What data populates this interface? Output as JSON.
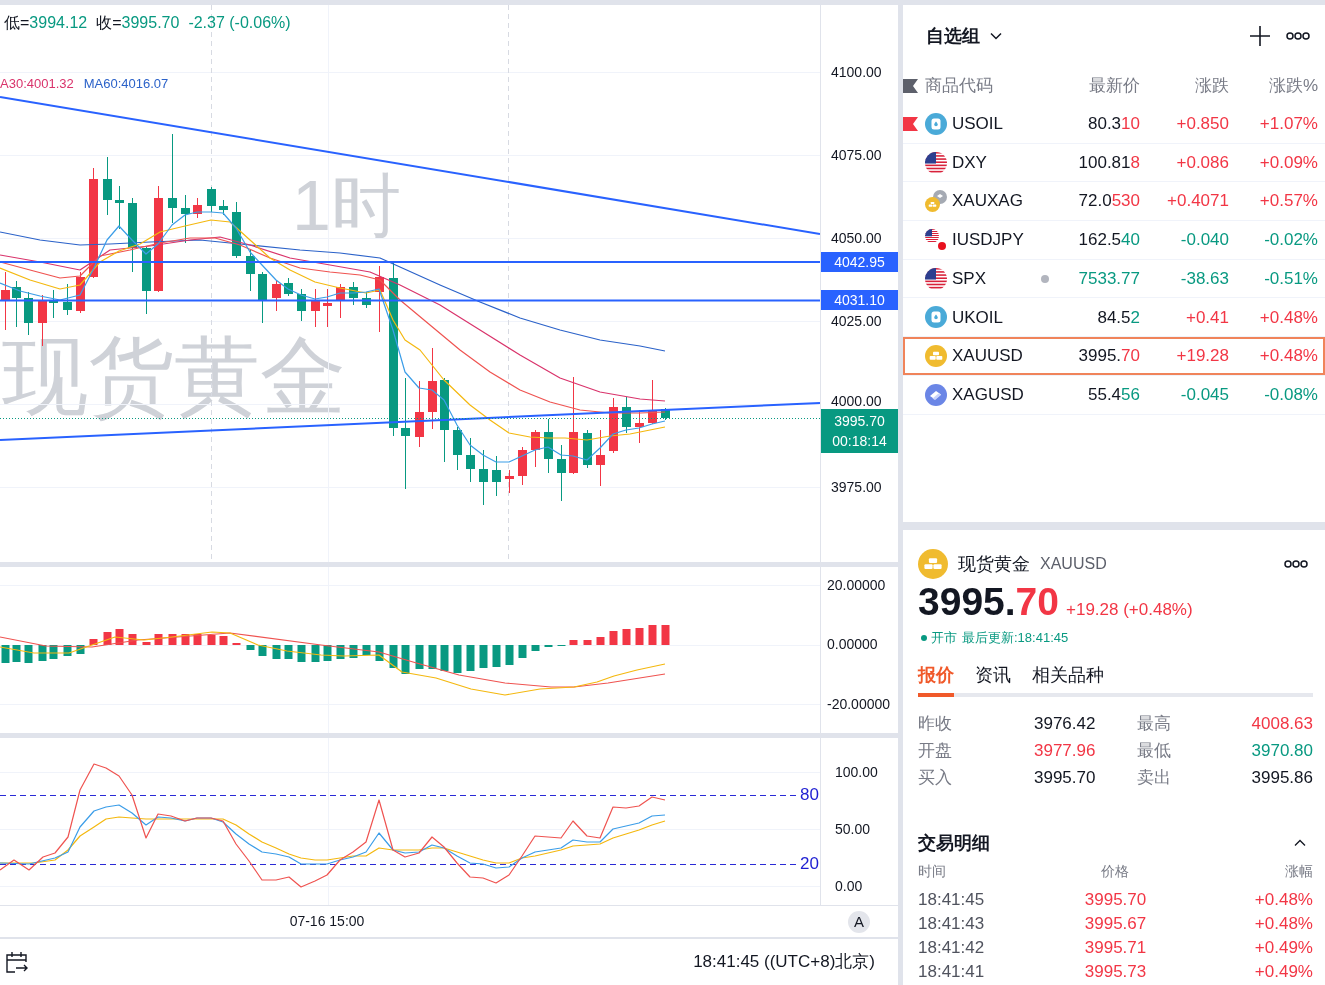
{
  "chart": {
    "legend": {
      "fields": [
        {
          "label": "低=",
          "value": "3994.12"
        },
        {
          "label": "收=",
          "value": "3995.70"
        }
      ],
      "change": "-2.37 (-0.06%)",
      "rising": false
    },
    "ma_legend": [
      {
        "label": "A30:4001.32",
        "color": "#d9336b"
      },
      {
        "label": "MA60:4016.07",
        "color": "#2b62c9"
      }
    ],
    "watermark": [
      "1时",
      "现货黄金"
    ],
    "price_axis": [
      {
        "kind": "tick",
        "label": "4100.00"
      },
      {
        "kind": "tick",
        "label": "4075.00"
      },
      {
        "kind": "tick",
        "label": "4050.00"
      },
      {
        "kind": "line",
        "label": "4042.95"
      },
      {
        "kind": "line",
        "label": "4031.10"
      },
      {
        "kind": "tick",
        "label": "4025.00"
      },
      {
        "kind": "tick",
        "label": "4000.00"
      },
      {
        "kind": "last",
        "label": "3995.70",
        "countdown": "00:18:14"
      },
      {
        "kind": "tick",
        "label": "3975.00"
      }
    ],
    "macd_axis": [
      "20.00000",
      "0.00000",
      "-20.00000"
    ],
    "stoch_axis": [
      "100.00",
      "50.00",
      "0.00"
    ],
    "stoch_levels": [
      "80",
      "20"
    ],
    "time_axis": [
      "07-16 15:00"
    ],
    "scale_button": "A"
  },
  "status_bar": {
    "clock": "18:41:45 ((UTC+8)北京)"
  },
  "watchlist": {
    "title": "自选组",
    "columns": [
      "商品代码",
      "最新价",
      "涨跌",
      "涨跌%"
    ],
    "rows": [
      {
        "symbol": "USOIL",
        "kind": "oil",
        "flagged": true,
        "closed": false,
        "selected": false,
        "price_head": "80.3",
        "price_tail": "10",
        "tick_rising": true,
        "change": "+0.850",
        "change_pct": "+1.07%",
        "rising": true
      },
      {
        "symbol": "DXY",
        "kind": "flag",
        "flagged": false,
        "closed": false,
        "selected": false,
        "price_head": "100.81",
        "price_tail": "8",
        "tick_rising": true,
        "change": "+0.086",
        "change_pct": "+0.09%",
        "rising": true
      },
      {
        "symbol": "XAUXAG",
        "kind": "ratio",
        "flagged": false,
        "closed": false,
        "selected": false,
        "price_head": "72.0",
        "price_tail": "530",
        "tick_rising": true,
        "change": "+0.4071",
        "change_pct": "+0.57%",
        "rising": true
      },
      {
        "symbol": "IUSDJPY",
        "kind": "pair",
        "flagged": false,
        "closed": false,
        "selected": false,
        "price_head": "162.5",
        "price_tail": "40",
        "tick_rising": false,
        "change": "-0.040",
        "change_pct": "-0.02%",
        "rising": false
      },
      {
        "symbol": "SPX",
        "kind": "flag",
        "flagged": false,
        "closed": true,
        "selected": false,
        "price_tail": "7533.77",
        "tick_rising": false,
        "change": "-38.63",
        "change_pct": "-0.51%",
        "rising": false
      },
      {
        "symbol": "UKOIL",
        "kind": "oil",
        "flagged": false,
        "closed": false,
        "selected": false,
        "price_head": "84.5",
        "price_tail": "2",
        "tick_rising": false,
        "change": "+0.41",
        "change_pct": "+0.48%",
        "rising": true
      },
      {
        "symbol": "XAUUSD",
        "kind": "bullion",
        "flagged": false,
        "closed": false,
        "selected": true,
        "price_head": "3995.",
        "price_tail": "70",
        "tick_rising": true,
        "change": "+19.28",
        "change_pct": "+0.48%",
        "rising": true
      },
      {
        "symbol": "XAGUSD",
        "kind": "ingot",
        "flagged": false,
        "closed": false,
        "selected": false,
        "price_head": "55.4",
        "price_tail": "56",
        "tick_rising": false,
        "change": "-0.045",
        "change_pct": "-0.08%",
        "rising": false
      }
    ]
  },
  "detail": {
    "name": "现货黄金",
    "symbol": "XAUUSD",
    "price_head": "3995.",
    "price_tail": "70",
    "tick_rising": true,
    "change": "+19.28 (+0.48%)",
    "rising": true,
    "market_open": true,
    "market_status": "开市",
    "updated": "最后更新:18:41:45",
    "tabs": [
      {
        "label": "报价",
        "selected": true
      },
      {
        "label": "资讯",
        "selected": false
      },
      {
        "label": "相关品种",
        "selected": false
      }
    ],
    "stats": [
      {
        "label": "昨收",
        "value": "3976.42",
        "color": "#131722"
      },
      {
        "label": "最高",
        "value": "4008.63",
        "color": "#f23645"
      },
      {
        "label": "开盘",
        "value": "3977.96",
        "color": "#f23645"
      },
      {
        "label": "最低",
        "value": "3970.80",
        "color": "#089981"
      },
      {
        "label": "买入",
        "value": "3995.70",
        "color": "#131722"
      },
      {
        "label": "卖出",
        "value": "3995.86",
        "color": "#131722"
      }
    ],
    "trades": {
      "title": "交易明细",
      "expanded": true,
      "columns": [
        "时间",
        "价格",
        "涨幅"
      ],
      "rows": [
        {
          "time": "18:41:45",
          "price": "3995.70",
          "change": "+0.48%",
          "rising": true
        },
        {
          "time": "18:41:43",
          "price": "3995.67",
          "change": "+0.48%",
          "rising": true
        },
        {
          "time": "18:41:42",
          "price": "3995.71",
          "change": "+0.49%",
          "rising": true
        },
        {
          "time": "18:41:41",
          "price": "3995.73",
          "change": "+0.49%",
          "rising": true
        }
      ]
    }
  }
}
